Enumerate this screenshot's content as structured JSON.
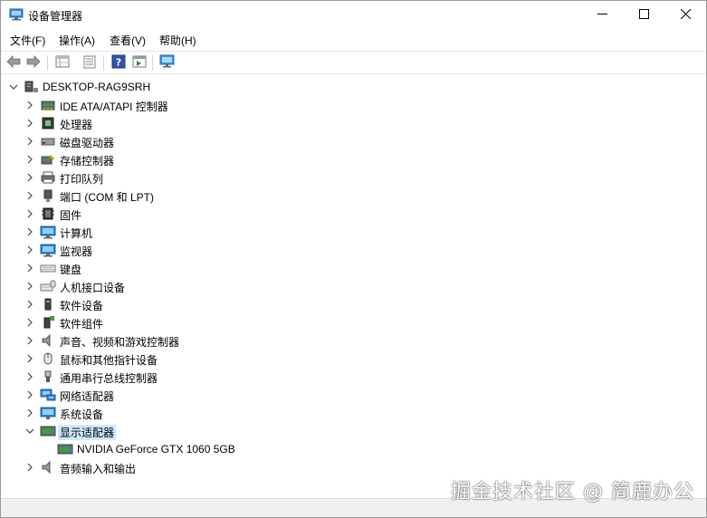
{
  "window": {
    "title": "设备管理器",
    "minimize_icon": "minimize-icon",
    "maximize_icon": "maximize-icon",
    "close_icon": "close-icon"
  },
  "menu": {
    "file": "文件(F)",
    "action": "操作(A)",
    "view": "查看(V)",
    "help": "帮助(H)"
  },
  "toolbar": {
    "buttons": [
      "back-icon",
      "forward-icon",
      "properties-grid-icon",
      "update-driver-icon",
      "help-icon",
      "run-icon",
      "monitor-icon"
    ]
  },
  "tree": {
    "root": "DESKTOP-RAG9SRH",
    "items": [
      {
        "label": "IDE ATA/ATAPI 控制器",
        "icon": "ide-controller-icon"
      },
      {
        "label": "处理器",
        "icon": "processor-icon"
      },
      {
        "label": "磁盘驱动器",
        "icon": "disk-drive-icon"
      },
      {
        "label": "存储控制器",
        "icon": "storage-controller-icon"
      },
      {
        "label": "打印队列",
        "icon": "printer-icon"
      },
      {
        "label": "端口 (COM 和 LPT)",
        "icon": "port-icon"
      },
      {
        "label": "固件",
        "icon": "firmware-icon"
      },
      {
        "label": "计算机",
        "icon": "computer-icon"
      },
      {
        "label": "监视器",
        "icon": "monitor-icon"
      },
      {
        "label": "键盘",
        "icon": "keyboard-icon"
      },
      {
        "label": "人机接口设备",
        "icon": "hid-icon"
      },
      {
        "label": "软件设备",
        "icon": "software-device-icon"
      },
      {
        "label": "软件组件",
        "icon": "software-component-icon"
      },
      {
        "label": "声音、视频和游戏控制器",
        "icon": "speaker-icon"
      },
      {
        "label": "鼠标和其他指针设备",
        "icon": "mouse-icon"
      },
      {
        "label": "通用串行总线控制器",
        "icon": "usb-icon"
      },
      {
        "label": "网络适配器",
        "icon": "network-adapter-icon"
      },
      {
        "label": "系统设备",
        "icon": "system-device-icon"
      },
      {
        "label": "显示适配器",
        "icon": "display-adapter-icon",
        "expanded": true,
        "selected": true
      },
      {
        "label": "NVIDIA GeForce GTX 1060 5GB",
        "icon": "display-adapter-icon",
        "child": true
      },
      {
        "label": "音频输入和输出",
        "icon": "speaker-icon"
      }
    ]
  },
  "watermark": "掘金技术社区 @ 简鹿办公",
  "colors": {
    "selection": "#cce8ff",
    "statusbar": "#f0f0f0"
  }
}
